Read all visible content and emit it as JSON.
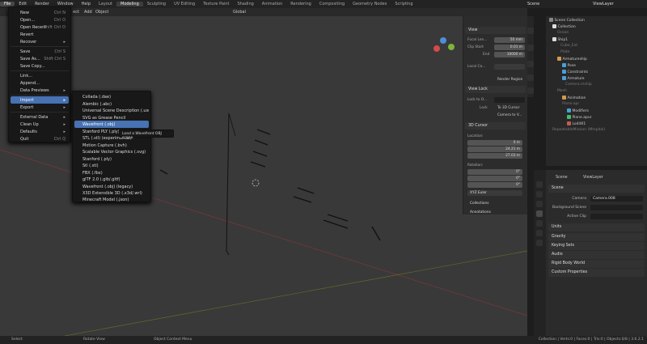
{
  "menubar": {
    "items": [
      "File",
      "Edit",
      "Render",
      "Window",
      "Help"
    ],
    "workspaces": [
      "Layout",
      "Modeling",
      "Sculpting",
      "UV Editing",
      "Texture Paint",
      "Shading",
      "Animation",
      "Rendering",
      "Compositing",
      "Geometry Nodes",
      "Scripting"
    ],
    "active_workspace": "Modeling",
    "scene": "Scene",
    "view_layer": "ViewLayer"
  },
  "viewport_header": {
    "partial_menu": "ect",
    "add": "Add",
    "object": "Object",
    "transform": "Global",
    "options": "Options"
  },
  "file_menu": {
    "items": [
      {
        "label": "New",
        "shortcut": "Ctrl N",
        "arrow": true
      },
      {
        "label": "Open...",
        "shortcut": "Ctrl O"
      },
      {
        "label": "Open Recent",
        "shortcut": "Shift Ctrl O",
        "arrow": true
      },
      {
        "label": "Revert"
      },
      {
        "label": "Recover",
        "arrow": true
      },
      {
        "label": "Save",
        "shortcut": "Ctrl S"
      },
      {
        "label": "Save As...",
        "shortcut": "Shift Ctrl S"
      },
      {
        "label": "Save Copy..."
      },
      {
        "label": "Link..."
      },
      {
        "label": "Append..."
      },
      {
        "label": "Data Previews",
        "arrow": true
      },
      {
        "label": "Import",
        "arrow": true,
        "highlighted": true
      },
      {
        "label": "Export",
        "arrow": true
      },
      {
        "label": "External Data",
        "arrow": true
      },
      {
        "label": "Clean Up",
        "arrow": true
      },
      {
        "label": "Defaults",
        "arrow": true
      },
      {
        "label": "Quit",
        "shortcut": "Ctrl Q"
      }
    ]
  },
  "import_menu": {
    "items": [
      "Collada (.dae)",
      "Alembic (.abc)",
      "Universal Scene Description (.usd*)",
      "SVG as Grease Pencil",
      "Wavefront (.obj)",
      "Stanford PLY (.ply) (experimental)",
      "STL (.stl) (experimental)",
      "Motion Capture (.bvh)",
      "Scalable Vector Graphics (.svg)",
      "Stanford (.ply)",
      "Stl (.stl)",
      "FBX (.fbx)",
      "glTF 2.0 (.glb/.gltf)",
      "Wavefront (.obj) (legacy)",
      "X3D Extensible 3D (.x3d/.wrl)",
      "Minecraft Model (.json)"
    ],
    "highlighted_index": 4,
    "tooltip": "Load a Wavefront OBJ scene."
  },
  "n_panel": {
    "view_header": "View",
    "focal_length_label": "Focal Len...",
    "focal_length": "50 mm",
    "clip_start_label": "Clip Start",
    "clip_start": "0.01 m",
    "clip_end_label": "End",
    "clip_end": "10000 m",
    "local_camera_label": "Local Ca...",
    "render_region": "Render Region",
    "view_lock_header": "View Lock",
    "lock_to_object_label": "Lock to O...",
    "lock_label": "Lock",
    "to_3d_cursor": "To 3D Cursor",
    "camera_to_view": "Camera to V...",
    "cursor_header": "3D Cursor",
    "location_label": "Location:",
    "loc_x": "0 m",
    "loc_y": "24.21 m",
    "loc_z": "27.03 m",
    "rotation_label": "Rotation:",
    "rot_x": "0°",
    "rot_y": "0°",
    "rot_z": "0°",
    "rotation_mode": "XYZ Euler",
    "collections": "Collections",
    "annotations": "Annotations",
    "tabs": [
      "Item",
      "Tool",
      "View",
      "MiChat",
      "Create"
    ]
  },
  "outliner": {
    "rows": [
      {
        "label": "Scene Collection",
        "indent": 0
      },
      {
        "label": "Collection",
        "indent": 1
      },
      {
        "label": "Ocean",
        "indent": 2,
        "dim": true
      },
      {
        "label": "Ship1",
        "indent": 1
      },
      {
        "label": "Cube_Ext",
        "indent": 2,
        "dim": true
      },
      {
        "label": "Plate",
        "indent": 2,
        "dim": true
      },
      {
        "label": "Armatureship",
        "indent": 2
      },
      {
        "label": "Pose",
        "indent": 3
      },
      {
        "label": "Constraints",
        "indent": 3
      },
      {
        "label": "Armature",
        "indent": 3
      },
      {
        "label": "Camera.mship",
        "indent": 3,
        "dim": true
      },
      {
        "label": "Mesh",
        "indent": 2,
        "dim": true
      },
      {
        "label": "Animation",
        "indent": 3
      },
      {
        "label": "Plane.apr",
        "indent": 3,
        "dim": true
      },
      {
        "label": "Modifiers",
        "indent": 4
      },
      {
        "label": "Plane.apur",
        "indent": 4
      },
      {
        "label": "Lo4it01",
        "indent": 4
      },
      {
        "label": "RepeatableMission (Mmpdai)",
        "indent": 1,
        "dim": true
      }
    ]
  },
  "properties": {
    "breadcrumb_scene": "Scene",
    "breadcrumb_layer": "ViewLayer",
    "scene_section": "Scene",
    "camera_label": "Camera",
    "camera_value": "Camera.008",
    "background_scene_label": "Background Scene",
    "active_clip_label": "Active Clip",
    "sections": [
      "Units",
      "Gravity",
      "Keying Sets",
      "Audio",
      "Rigid Body World",
      "Custom Properties"
    ]
  },
  "statusbar": {
    "select": "Select",
    "rotate": "Rotate View",
    "context": "Object Context Menu",
    "stats": "Collection | Verts:0 | Faces:0 | Tris:0 | Objects:0/8 | 3.6.2.1"
  },
  "colors": {
    "accent": "#4772b3",
    "grid_x": "#8a3b3b",
    "grid_y": "#6d7a2b"
  }
}
